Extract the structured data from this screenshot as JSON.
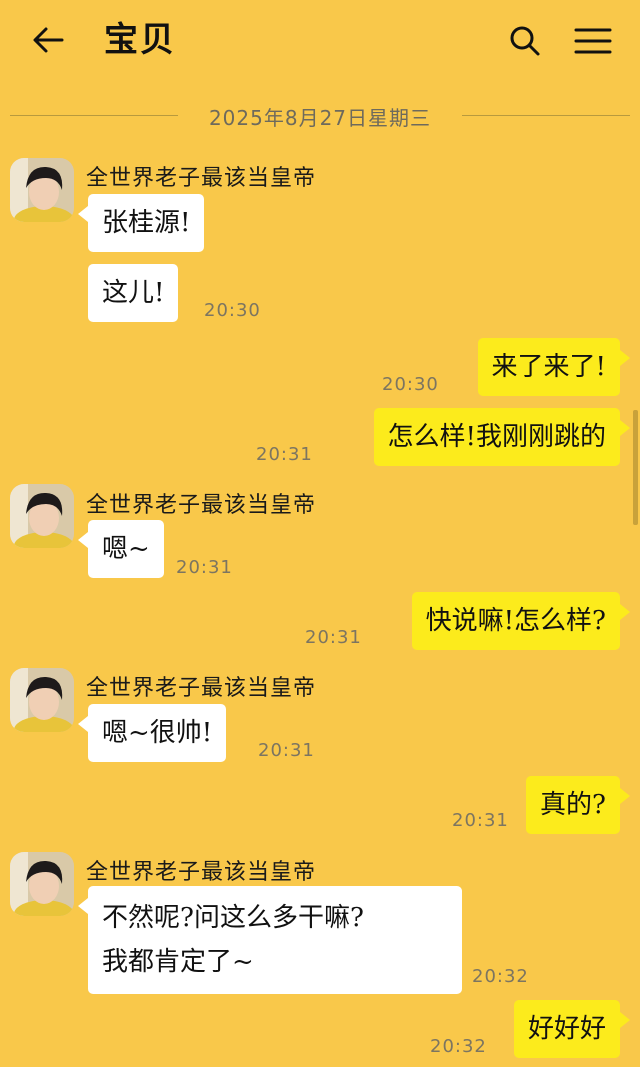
{
  "header": {
    "title": "宝贝"
  },
  "date_divider": "2025年8月27日星期三",
  "contact_name": "全世界老子最该当皇帝",
  "messages": [
    {
      "text": "张桂源!"
    },
    {
      "text": "这儿!",
      "time": "20:30"
    },
    {
      "text": "来了来了!",
      "time": "20:30"
    },
    {
      "text": "怎么样!我刚刚跳的",
      "time": "20:31"
    },
    {
      "text": "嗯~",
      "time": "20:31"
    },
    {
      "text": "快说嘛!怎么样?",
      "time": "20:31"
    },
    {
      "text": "嗯~很帅!",
      "time": "20:31"
    },
    {
      "text": "真的?",
      "time": "20:31"
    },
    {
      "text_lines": [
        "不然呢?问这么多干嘛?",
        "我都肯定了~"
      ],
      "time": "20:32"
    },
    {
      "text": "好好好",
      "time": "20:32"
    }
  ]
}
